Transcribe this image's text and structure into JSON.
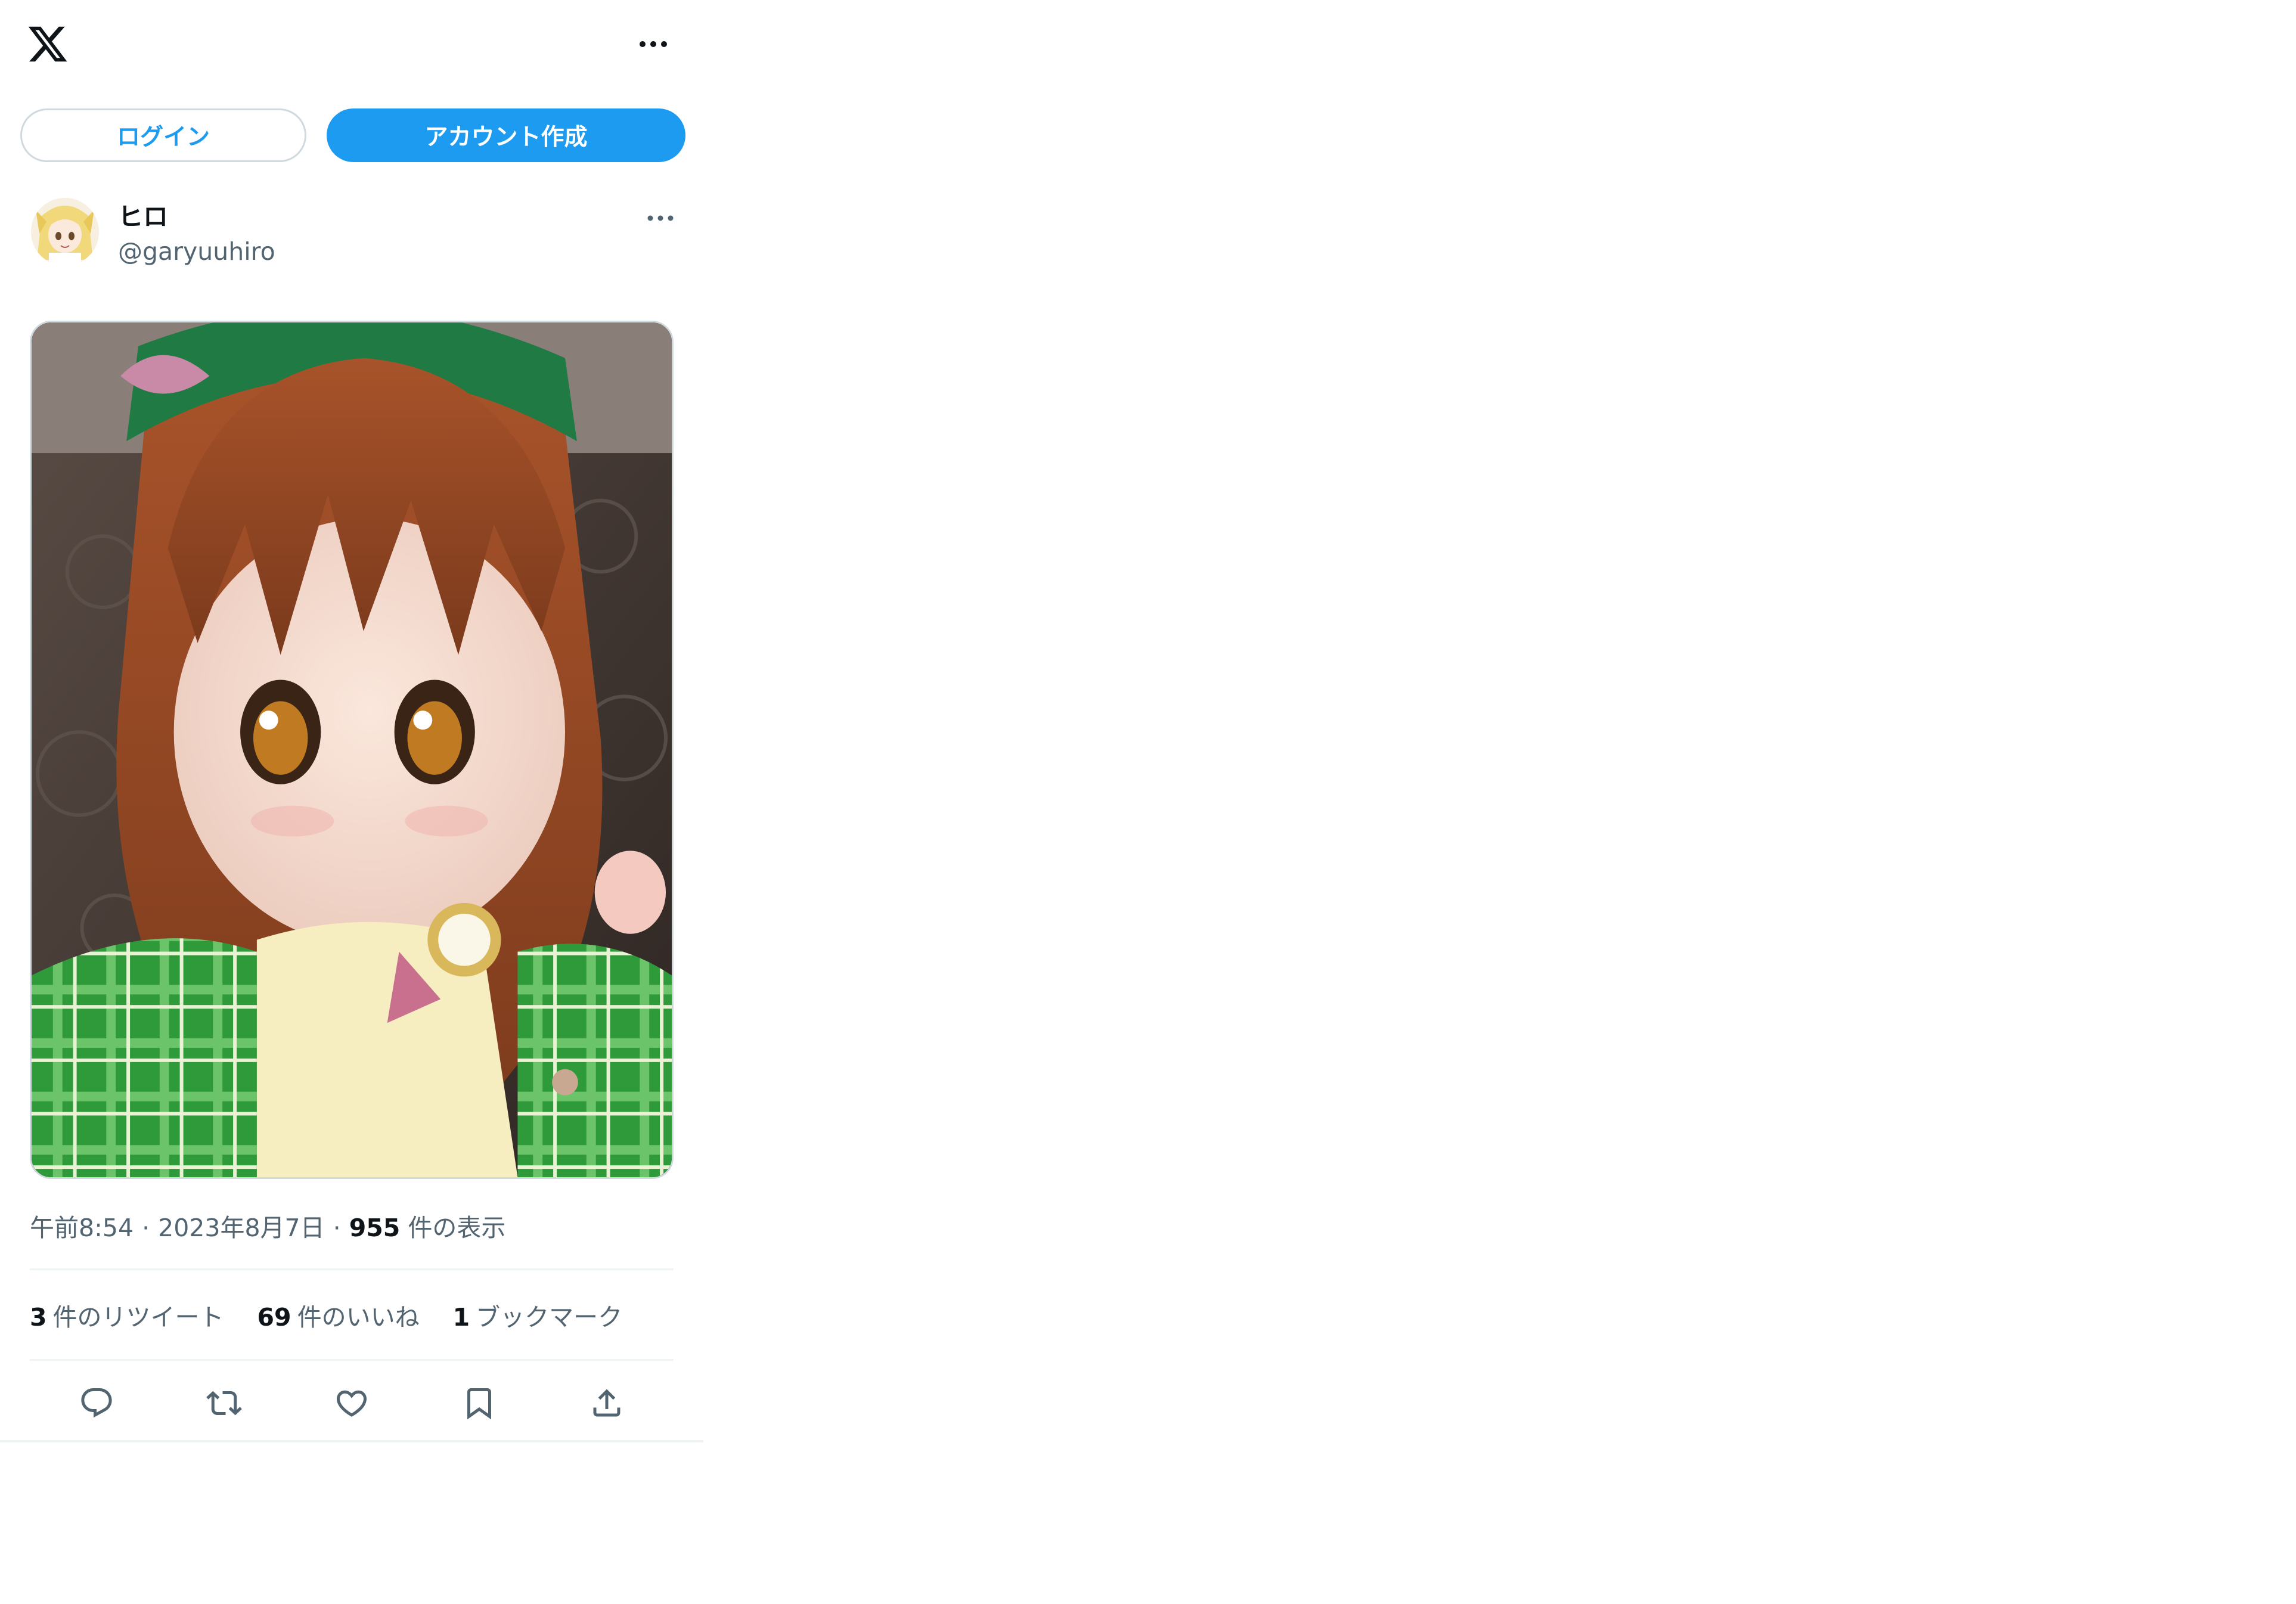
{
  "header": {
    "logo_icon": "x-logo-icon",
    "more_icon": "more-horizontal-icon"
  },
  "auth": {
    "login_label": "ログイン",
    "signup_label": "アカウント作成",
    "accent_color": "#1d9bf0"
  },
  "post": {
    "author_name": "ヒロ",
    "author_handle": "@garyuuhiro",
    "more_icon": "more-horizontal-icon",
    "media_alt": "photo",
    "time": "午前8:54",
    "date": "2023年8月7日",
    "views_count": "955",
    "views_label": "件の表示",
    "separator": "·"
  },
  "stats": [
    {
      "count": "3",
      "label": "件のリツイート"
    },
    {
      "count": "69",
      "label": "件のいいね"
    },
    {
      "count": "1",
      "label": "ブックマーク"
    }
  ],
  "actions": [
    {
      "icon": "reply-icon"
    },
    {
      "icon": "retweet-icon"
    },
    {
      "icon": "like-heart-icon"
    },
    {
      "icon": "bookmark-icon"
    },
    {
      "icon": "share-upload-icon"
    }
  ]
}
